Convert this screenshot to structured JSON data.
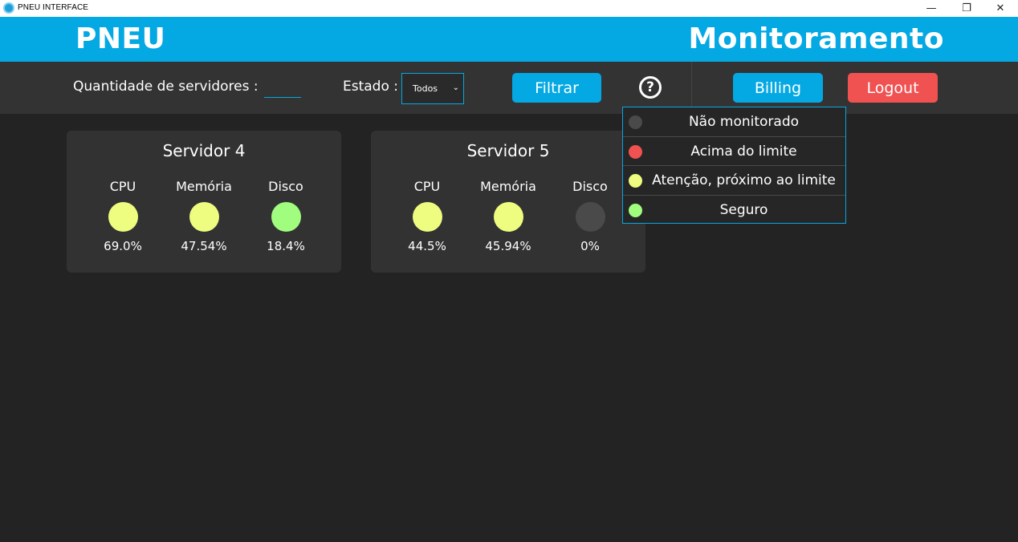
{
  "window": {
    "title": "PNEU INTERFACE",
    "minimize": "—",
    "maximize": "❐",
    "close": "✕"
  },
  "header": {
    "brand": "PNEU",
    "heading": "Monitoramento",
    "color": "#04a8e2"
  },
  "toolbar": {
    "qty_label": "Quantidade de servidores :",
    "qty_value": "",
    "estado_label": "Estado :",
    "estado_selected": "Todos",
    "filtrar_label": "Filtrar",
    "help_symbol": "?",
    "billing_label": "Billing",
    "logout_label": "Logout"
  },
  "colors": {
    "gray": "#4a4a4a",
    "red": "#f05252",
    "yellow": "#eefc7f",
    "green": "#a0fd7e"
  },
  "legend": {
    "items": [
      {
        "label": "Não monitorado",
        "color": "#4a4a4a"
      },
      {
        "label": "Acima do limite",
        "color": "#f05252"
      },
      {
        "label": "Atenção, próximo ao limite",
        "color": "#eefc7f"
      },
      {
        "label": "Seguro",
        "color": "#a0fd7e"
      }
    ]
  },
  "servers": [
    {
      "name": "Servidor 4",
      "metrics": [
        {
          "label": "CPU",
          "value": "69.0%",
          "color": "#eefc7f"
        },
        {
          "label": "Memória",
          "value": "47.54%",
          "color": "#eefc7f"
        },
        {
          "label": "Disco",
          "value": "18.4%",
          "color": "#a0fd7e"
        }
      ]
    },
    {
      "name": "Servidor 5",
      "metrics": [
        {
          "label": "CPU",
          "value": "44.5%",
          "color": "#eefc7f"
        },
        {
          "label": "Memória",
          "value": "45.94%",
          "color": "#eefc7f"
        },
        {
          "label": "Disco",
          "value": "0%",
          "color": "#4a4a4a"
        }
      ]
    }
  ]
}
